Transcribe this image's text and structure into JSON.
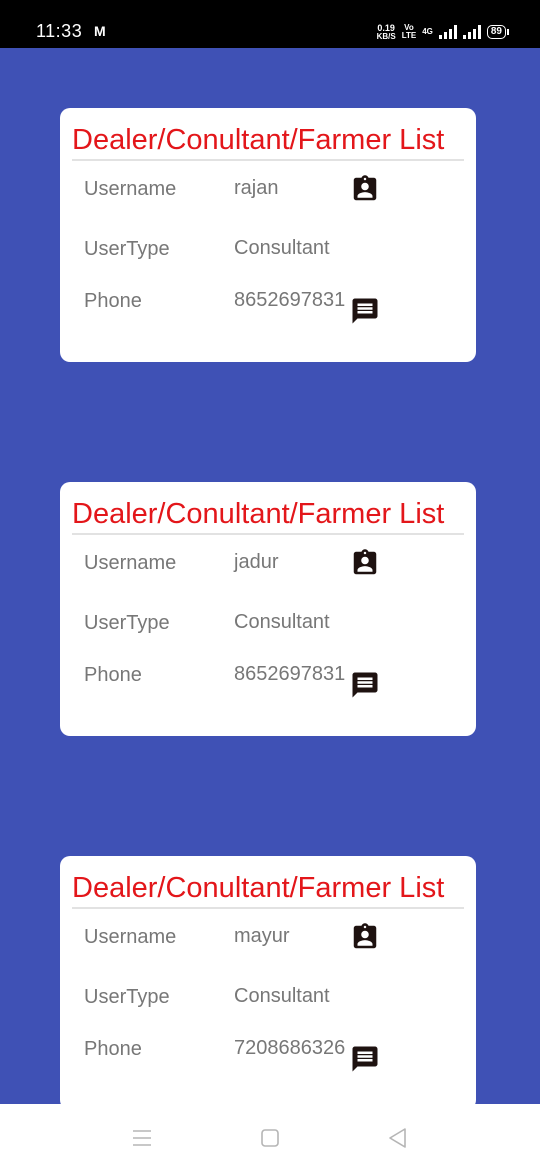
{
  "status_bar": {
    "time": "11:33",
    "mail_icon": "M",
    "net_speed": "0.19",
    "net_unit": "KB/S",
    "volte_top": "Vo",
    "volte_bottom": "LTE",
    "network": "4G",
    "battery": "89"
  },
  "cards": [
    {
      "title": "Dealer/Conultant/Farmer List",
      "username_label": "Username",
      "username": "rajan",
      "usertype_label": "UserType",
      "usertype": "Consultant",
      "phone_label": "Phone",
      "phone": "8652697831"
    },
    {
      "title": "Dealer/Conultant/Farmer List",
      "username_label": "Username",
      "username": "jadur",
      "usertype_label": "UserType",
      "usertype": "Consultant",
      "phone_label": "Phone",
      "phone": "8652697831"
    },
    {
      "title": "Dealer/Conultant/Farmer List",
      "username_label": "Username",
      "username": "mayur",
      "usertype_label": "UserType",
      "usertype": "Consultant",
      "phone_label": "Phone",
      "phone": "7208686326"
    }
  ],
  "icons": {
    "contact": "contact-badge-icon",
    "message": "message-icon",
    "color": "#1e1210"
  },
  "colors": {
    "background": "#3f51b5",
    "title": "#e3161a",
    "text": "#777777"
  }
}
